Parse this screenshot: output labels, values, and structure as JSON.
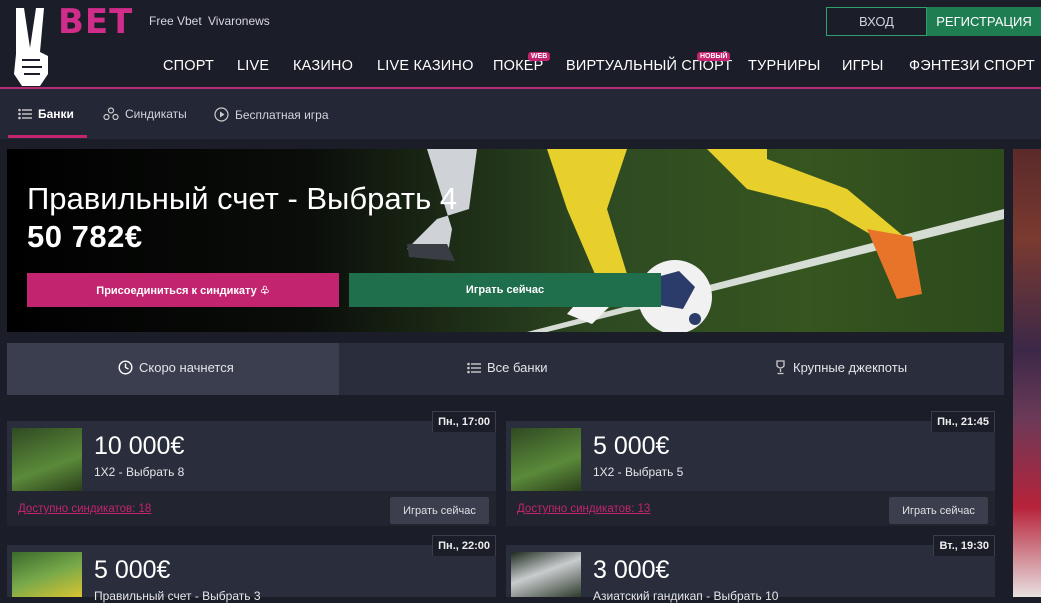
{
  "header": {
    "logo_text": "BET",
    "links": [
      "Free Vbet",
      "Vivaronews"
    ],
    "login_label": "ВХОД",
    "register_label": "РЕГИСТРАЦИЯ"
  },
  "nav": {
    "items": [
      "СПОРТ",
      "LIVE",
      "КАЗИНО",
      "LIVE КАЗИНО",
      "ПОКЕР",
      "ВИРТУАЛЬНЫЙ СПОРТ",
      "ТУРНИРЫ",
      "ИГРЫ",
      "ФЭНТЕЗИ СПОРТ"
    ],
    "poker_badge": "WEB",
    "virtual_badge": "НОВЫЙ",
    "accent_color": "#c2246f"
  },
  "subnav": {
    "items": [
      "Банки",
      "Синдикаты",
      "Бесплатная игра"
    ],
    "active": "Банки"
  },
  "banner": {
    "title": "Правильный счет - Выбрать 4",
    "amount": "50 782€",
    "join_label": "Присоединиться к синдикату ♧",
    "play_label": "Играть сейчас"
  },
  "tabs": {
    "items": [
      "Скоро начнется",
      "Все банки",
      "Крупные джекпоты"
    ],
    "active": "Скоро начнется"
  },
  "cards": [
    {
      "time": "Пн., 17:00",
      "amount": "10 000€",
      "game": "1X2 - Выбрать 8",
      "synd": "Доступно синдикатов: 18",
      "btn": "Играть сейчас"
    },
    {
      "time": "Пн., 21:45",
      "amount": "5 000€",
      "game": "1X2 - Выбрать 5",
      "synd": "Доступно синдикатов: 13",
      "btn": "Играть сейчас"
    },
    {
      "time": "Пн., 22:00",
      "amount": "5 000€",
      "game": "Правильный счет - Выбрать 3",
      "synd": "",
      "btn": ""
    },
    {
      "time": "Вт., 19:30",
      "amount": "3 000€",
      "game": "Азиатский гандикап - Выбрать 10",
      "synd": "",
      "btn": ""
    }
  ],
  "icons": [
    "list-icon",
    "syndicate-icon",
    "play-circle-icon",
    "clock-icon",
    "trophy-icon",
    "peace-hand-icon"
  ]
}
